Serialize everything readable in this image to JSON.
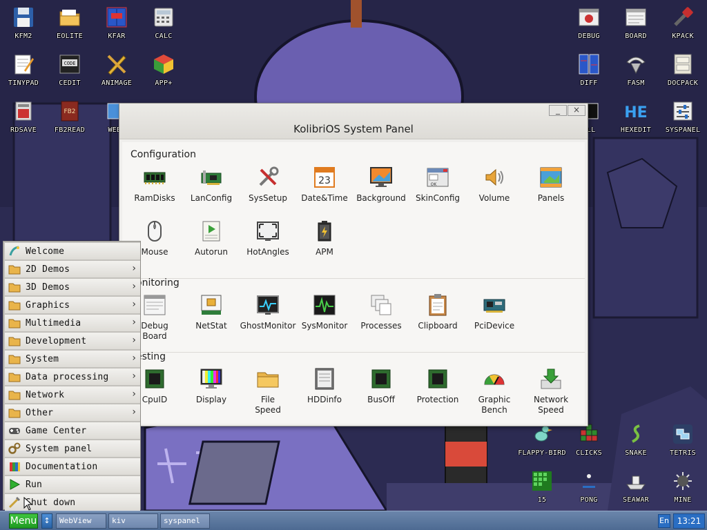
{
  "desktop": {
    "icons_left": [
      {
        "label": "KFM2",
        "icon": "floppy-icon"
      },
      {
        "label": "EOLITE",
        "icon": "folder-icon"
      },
      {
        "label": "KFAR",
        "icon": "kfar-icon"
      },
      {
        "label": "CALC",
        "icon": "calculator-icon"
      },
      {
        "label": "TINYPAD",
        "icon": "notepad-icon"
      },
      {
        "label": "CEDIT",
        "icon": "code-editor-icon"
      },
      {
        "label": "ANIMAGE",
        "icon": "paint-icon"
      },
      {
        "label": "APP+",
        "icon": "cube-icon"
      },
      {
        "label": "RDSAVE",
        "icon": "ramdisk-save-icon"
      },
      {
        "label": "FB2READ",
        "icon": "book-icon"
      },
      {
        "label": "WEBV",
        "icon": "web-icon"
      }
    ],
    "icons_right": [
      {
        "label": "DEBUG",
        "icon": "debug-icon"
      },
      {
        "label": "BOARD",
        "icon": "board-icon"
      },
      {
        "label": "KPACK",
        "icon": "kpack-icon"
      },
      {
        "label": "DIFF",
        "icon": "diff-icon"
      },
      {
        "label": "FASM",
        "icon": "fasm-icon"
      },
      {
        "label": "DOCPACK",
        "icon": "docpack-icon"
      },
      {
        "label": "ELL",
        "icon": "shell-icon"
      },
      {
        "label": "HEXEDIT",
        "icon": "hexedit-icon"
      },
      {
        "label": "SYSPANEL",
        "icon": "syspanel-icon"
      }
    ],
    "icons_games": [
      {
        "label": "FLAPPY-BIRD",
        "icon": "bird-icon"
      },
      {
        "label": "CLICKS",
        "icon": "clicks-icon"
      },
      {
        "label": "SNAKE",
        "icon": "snake-icon"
      },
      {
        "label": "TETRIS",
        "icon": "tetris-icon"
      },
      {
        "label": "15",
        "icon": "fifteen-icon"
      },
      {
        "label": "PONG",
        "icon": "pong-icon"
      },
      {
        "label": "SEAWAR",
        "icon": "ship-icon"
      },
      {
        "label": "MINE",
        "icon": "mine-icon"
      }
    ]
  },
  "panel": {
    "title": "KolibriOS System Panel",
    "minimize": "_",
    "close": "×",
    "sections": [
      {
        "title": "Configuration",
        "items": [
          "RamDisks",
          "LanConfig",
          "SysSetup",
          "Date&Time",
          "Background",
          "SkinConfig",
          "Volume",
          "Panels",
          "Mouse",
          "Autorun",
          "HotAngles",
          "APM"
        ]
      },
      {
        "title": "onitoring",
        "items": [
          "Debug\nBoard",
          "NetStat",
          "GhostMonitor",
          "SysMonitor",
          "Processes",
          "Clipboard",
          "PciDevice"
        ]
      },
      {
        "title": "esting",
        "items": [
          "CpuID",
          "Display",
          "File\nSpeed",
          "HDDinfo",
          "BusOff",
          "Protection",
          "Graphic\nBench",
          "Network\nSpeed"
        ]
      }
    ],
    "date_icon_text": "23"
  },
  "menu": {
    "items": [
      {
        "label": "Welcome",
        "icon": "welcome-icon",
        "submenu": false
      },
      {
        "label": "2D Demos",
        "icon": "folder-icon",
        "submenu": true
      },
      {
        "label": "3D Demos",
        "icon": "folder-icon",
        "submenu": true
      },
      {
        "label": "Graphics",
        "icon": "folder-icon",
        "submenu": true
      },
      {
        "label": "Multimedia",
        "icon": "folder-icon",
        "submenu": true
      },
      {
        "label": "Development",
        "icon": "folder-icon",
        "submenu": true
      },
      {
        "label": "System",
        "icon": "folder-icon",
        "submenu": true
      },
      {
        "label": "Data processing",
        "icon": "folder-icon",
        "submenu": true
      },
      {
        "label": "Network",
        "icon": "folder-icon",
        "submenu": true
      },
      {
        "label": "Other",
        "icon": "folder-icon",
        "submenu": true
      },
      {
        "label": "Game Center",
        "icon": "gamepad-icon",
        "submenu": false
      },
      {
        "label": "System panel",
        "icon": "gears-icon",
        "submenu": false
      },
      {
        "label": "Documentation",
        "icon": "books-icon",
        "submenu": false
      },
      {
        "label": "Run",
        "icon": "play-icon",
        "submenu": false
      },
      {
        "label": "Shut down",
        "icon": "shutdown-icon",
        "submenu": false
      }
    ],
    "chevron": "›"
  },
  "taskbar": {
    "menu_label": "Menu",
    "switch_label": "↕",
    "tasks": [
      "WebView",
      "kiv",
      "syspanel"
    ],
    "language": "En",
    "clock": "13:21"
  },
  "colors": {
    "panel_bg": "#efeeec",
    "menu_button": "#2fb02f",
    "taskbar": "#5b779e",
    "clock_bg": "#2a6ec3"
  }
}
